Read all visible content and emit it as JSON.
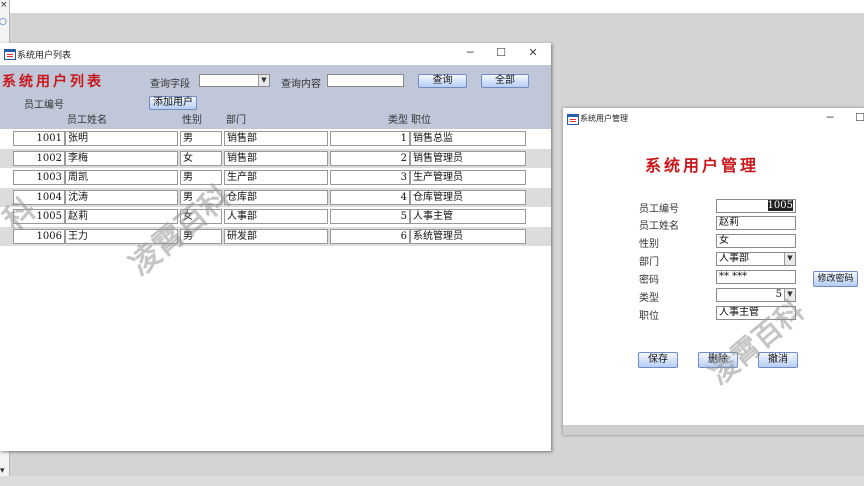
{
  "list_window": {
    "title": "系统用户列表",
    "heading": "系统用户列表",
    "query_field_label": "查询字段",
    "query_field_value": "",
    "query_content_label": "查询内容",
    "query_content_value": "",
    "query_button": "查询",
    "all_button": "全部",
    "add_user_button": "添加用户",
    "columns": [
      "员工编号",
      "员工姓名",
      "性别",
      "部门",
      "类型",
      "职位"
    ],
    "rows": [
      {
        "id": "1001",
        "name": "张明",
        "gender": "男",
        "dept": "销售部",
        "type": "1",
        "position": "销售总监"
      },
      {
        "id": "1002",
        "name": "李梅",
        "gender": "女",
        "dept": "销售部",
        "type": "2",
        "position": "销售管理员"
      },
      {
        "id": "1003",
        "name": "周凯",
        "gender": "男",
        "dept": "生产部",
        "type": "3",
        "position": "生产管理员"
      },
      {
        "id": "1004",
        "name": "沈涛",
        "gender": "男",
        "dept": "仓库部",
        "type": "4",
        "position": "仓库管理员"
      },
      {
        "id": "1005",
        "name": "赵莉",
        "gender": "女",
        "dept": "人事部",
        "type": "5",
        "position": "人事主管"
      },
      {
        "id": "1006",
        "name": "王力",
        "gender": "男",
        "dept": "研发部",
        "type": "6",
        "position": "系统管理员"
      }
    ]
  },
  "manage_window": {
    "title": "系统用户管理",
    "heading": "系统用户管理",
    "fields": {
      "id": {
        "label": "员工编号",
        "value": "1005"
      },
      "name": {
        "label": "员工姓名",
        "value": "赵莉"
      },
      "gender": {
        "label": "性别",
        "value": "女"
      },
      "dept": {
        "label": "部门",
        "value": "人事部"
      },
      "password": {
        "label": "密码",
        "value": "** ***"
      },
      "type": {
        "label": "类型",
        "value": "5"
      },
      "position": {
        "label": "职位",
        "value": "人事主管"
      }
    },
    "change_password_button": "修改密码",
    "save_button": "保存",
    "delete_button": "删除",
    "cancel_button": "撤消"
  },
  "watermark": {
    "text1": "科",
    "text2": "凌霄百科",
    "text3": "凌霄百科"
  },
  "colors": {
    "title_red": "#c8181c",
    "header_bg": "#bfc7d8",
    "button_blue": "#b7cdf2"
  }
}
